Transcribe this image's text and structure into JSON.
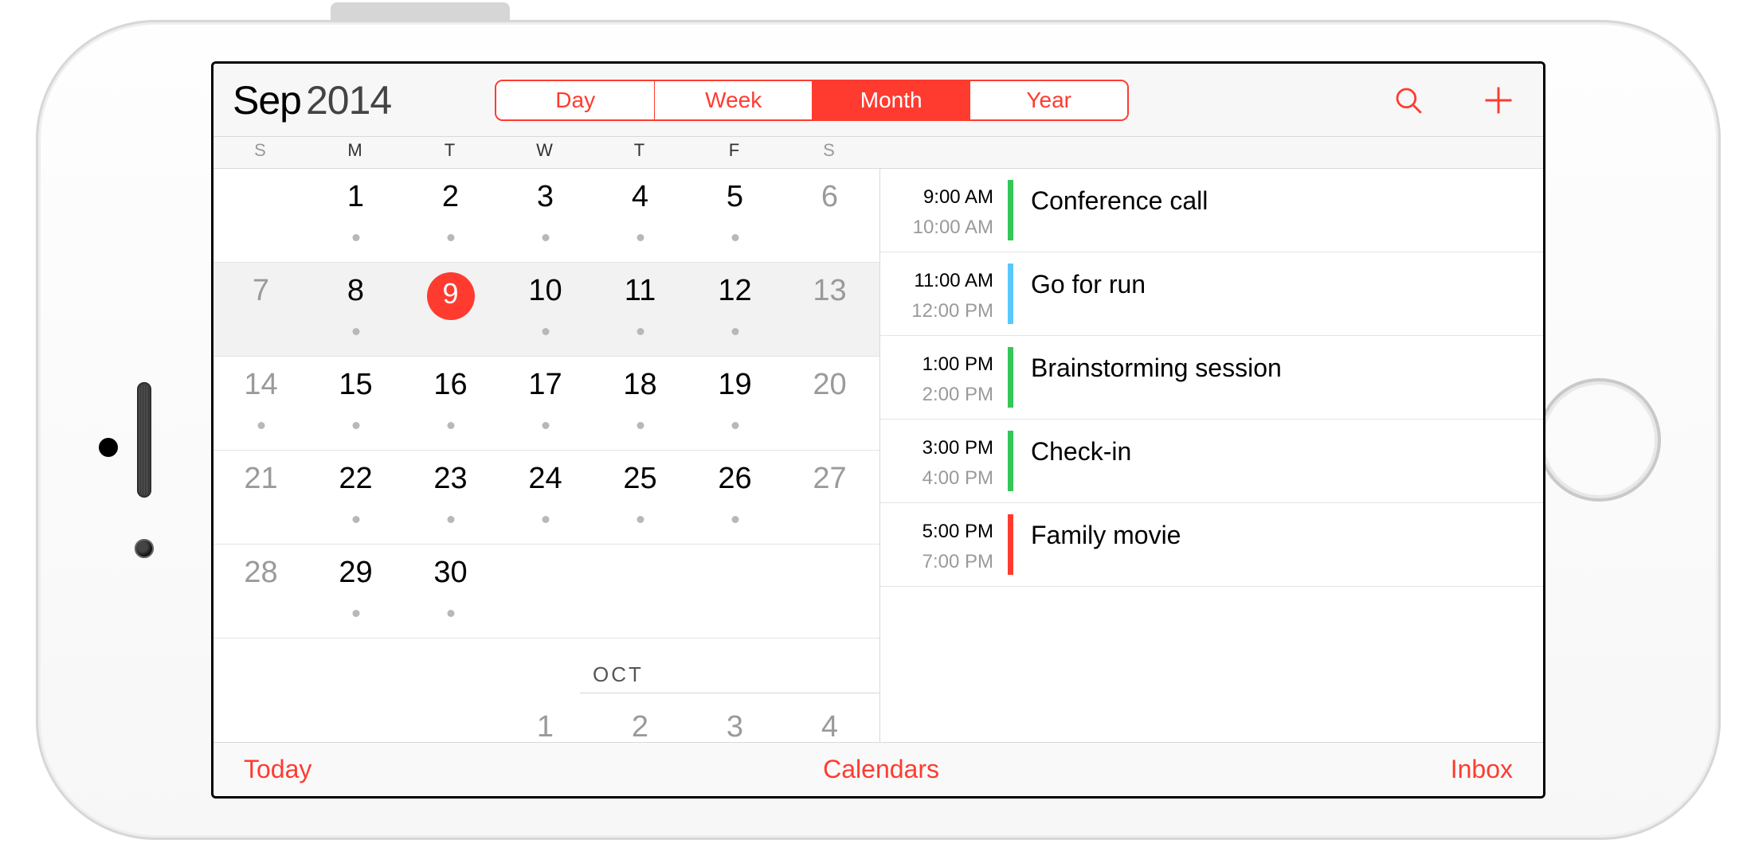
{
  "header": {
    "month": "Sep",
    "year": "2014",
    "segments": [
      "Day",
      "Week",
      "Month",
      "Year"
    ],
    "active_segment": "Month"
  },
  "dow": [
    "S",
    "M",
    "T",
    "W",
    "T",
    "F",
    "S"
  ],
  "weeks": [
    {
      "days": [
        {
          "n": "",
          "we": true
        },
        {
          "n": "1",
          "dot": true
        },
        {
          "n": "2",
          "dot": true
        },
        {
          "n": "3",
          "dot": true
        },
        {
          "n": "4",
          "dot": true
        },
        {
          "n": "5",
          "dot": true
        },
        {
          "n": "6",
          "we": true
        }
      ]
    },
    {
      "sel": true,
      "days": [
        {
          "n": "7",
          "we": true
        },
        {
          "n": "8",
          "dot": true
        },
        {
          "n": "9",
          "today": true
        },
        {
          "n": "10",
          "dot": true
        },
        {
          "n": "11",
          "dot": true
        },
        {
          "n": "12",
          "dot": true
        },
        {
          "n": "13",
          "we": true
        }
      ]
    },
    {
      "days": [
        {
          "n": "14",
          "we": true,
          "dot": true
        },
        {
          "n": "15",
          "dot": true
        },
        {
          "n": "16",
          "dot": true
        },
        {
          "n": "17",
          "dot": true
        },
        {
          "n": "18",
          "dot": true
        },
        {
          "n": "19",
          "dot": true
        },
        {
          "n": "20",
          "we": true
        }
      ]
    },
    {
      "days": [
        {
          "n": "21",
          "we": true
        },
        {
          "n": "22",
          "dot": true
        },
        {
          "n": "23",
          "dot": true
        },
        {
          "n": "24",
          "dot": true
        },
        {
          "n": "25",
          "dot": true
        },
        {
          "n": "26",
          "dot": true
        },
        {
          "n": "27",
          "we": true
        }
      ]
    },
    {
      "days": [
        {
          "n": "28",
          "we": true
        },
        {
          "n": "29",
          "dot": true
        },
        {
          "n": "30",
          "dot": true
        },
        {
          "n": ""
        },
        {
          "n": ""
        },
        {
          "n": ""
        },
        {
          "n": "",
          "we": true
        }
      ]
    }
  ],
  "next_month_label": "OCT",
  "next_week": [
    {
      "n": ""
    },
    {
      "n": ""
    },
    {
      "n": ""
    },
    {
      "n": "1"
    },
    {
      "n": "2"
    },
    {
      "n": "3"
    },
    {
      "n": "4"
    }
  ],
  "events": [
    {
      "start": "9:00 AM",
      "end": "10:00 AM",
      "title": "Conference call",
      "color": "#34c759"
    },
    {
      "start": "11:00 AM",
      "end": "12:00 PM",
      "title": "Go for run",
      "color": "#5ac8fa"
    },
    {
      "start": "1:00 PM",
      "end": "2:00 PM",
      "title": "Brainstorming session",
      "color": "#34c759"
    },
    {
      "start": "3:00 PM",
      "end": "4:00 PM",
      "title": "Check-in",
      "color": "#34c759"
    },
    {
      "start": "5:00 PM",
      "end": "7:00 PM",
      "title": "Family movie",
      "color": "#ff3b30"
    }
  ],
  "bottom": {
    "today": "Today",
    "calendars": "Calendars",
    "inbox": "Inbox"
  }
}
